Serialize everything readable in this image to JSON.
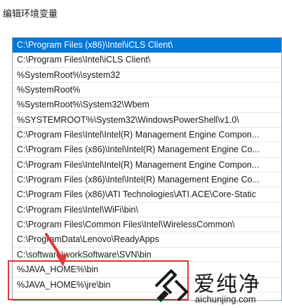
{
  "window": {
    "title": "编辑环境变量"
  },
  "list": {
    "items": [
      "C:\\Program Files (x86)\\Intel\\iCLS Client\\",
      "C:\\Program Files\\Intel\\iCLS Client\\",
      "%SystemRoot%\\system32",
      "%SystemRoot%",
      "%SystemRoot%\\System32\\Wbem",
      "%SYSTEMROOT%\\System32\\WindowsPowerShell\\v1.0\\",
      "C:\\Program Files\\Intel\\Intel(R) Management Engine Compon...",
      "C:\\Program Files (x86)\\Intel\\Intel(R) Management Engine Co...",
      "C:\\Program Files\\Intel\\Intel(R) Management Engine Compon...",
      "C:\\Program Files (x86)\\Intel\\Intel(R) Management Engine Co...",
      "C:\\Program Files (x86)\\ATI Technologies\\ATI.ACE\\Core-Static",
      "C:\\Program Files\\Intel\\WiFi\\bin\\",
      "C:\\Program Files\\Common Files\\Intel\\WirelessCommon\\",
      "C:\\ProgramData\\Lenovo\\ReadyApps",
      "C:\\software\\workSoftware\\SVN\\bin",
      "%JAVA_HOME%\\bin",
      "%JAVA_HOME%\\jre\\bin"
    ],
    "selected_index": 0
  },
  "annotation": {
    "color": "#e2373b"
  },
  "selection_color": "#0078d7",
  "watermark": {
    "name": "爱纯净",
    "url": "aichunjing.com"
  }
}
